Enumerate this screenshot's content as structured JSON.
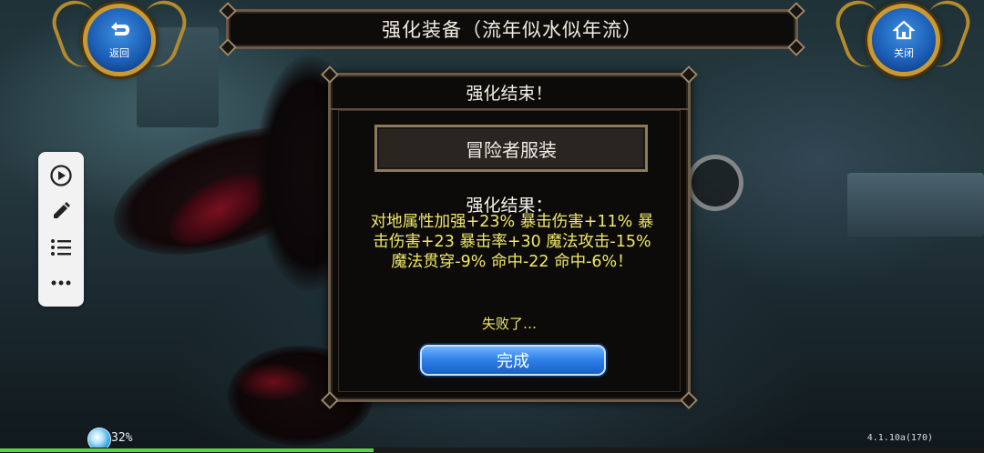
{
  "header": {
    "title": "强化装备（流年似水似年流）"
  },
  "buttons": {
    "back_label": "返回",
    "close_label": "关闭"
  },
  "toolbar": {
    "items": [
      {
        "icon": "play-circle-icon"
      },
      {
        "icon": "pencil-icon"
      },
      {
        "icon": "list-icon"
      },
      {
        "icon": "more-horizontal-icon"
      }
    ]
  },
  "dialog": {
    "title": "强化结束！",
    "item_name": "冒险者服装",
    "result_heading": "强化结果：",
    "result_lines": [
      "对地属性加强+23% 暴击伤害+11% 暴",
      "击伤害+23 暴击率+30 魔法攻击-15%",
      "魔法贯穿-9% 命中-22 命中-6%！"
    ],
    "status_text": "失败了…",
    "done_label": "完成"
  },
  "footer": {
    "percent": "32%",
    "exp_progress": 0.38,
    "version": "4.1.10a(170)"
  },
  "colors": {
    "result_text": "#f1e866",
    "button_blue": "#2b7fe6",
    "frame_gold": "#c99a33"
  }
}
